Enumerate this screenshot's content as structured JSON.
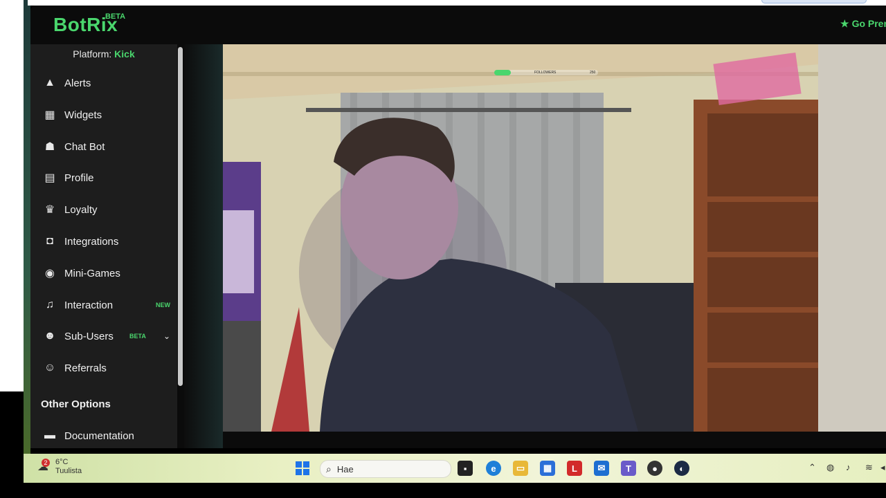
{
  "app": {
    "logo": "BotRix",
    "logo_badge": "BETA",
    "go_premium": "Go Prer"
  },
  "sidebar": {
    "platform_label": "Platform:",
    "platform_value": "Kick",
    "items": [
      {
        "label": "Alerts",
        "icon": "warning-icon"
      },
      {
        "label": "Widgets",
        "icon": "grid-icon"
      },
      {
        "label": "Chat Bot",
        "icon": "robot-icon"
      },
      {
        "label": "Profile",
        "icon": "id-card-icon"
      },
      {
        "label": "Loyalty",
        "icon": "trophy-icon"
      },
      {
        "label": "Integrations",
        "icon": "chat-icon"
      },
      {
        "label": "Mini-Games",
        "icon": "gamepad-icon"
      },
      {
        "label": "Interaction",
        "icon": "music-icon",
        "badge": "NEW"
      },
      {
        "label": "Sub-Users",
        "icon": "users-icon",
        "badge": "BETA"
      },
      {
        "label": "Referrals",
        "icon": "user-friends-icon"
      }
    ],
    "section_title": "Other Options",
    "other_items": [
      {
        "label": "Documentation",
        "icon": "book-icon"
      }
    ]
  },
  "video_overlay": {
    "label": "FOLLOWERS",
    "current": "63",
    "target": "250",
    "progress": 0.16
  },
  "taskbar": {
    "weather_badge": "2",
    "weather_temp": "6°C",
    "weather_desc": "Tuulista",
    "search_placeholder": "Hae",
    "apps": [
      "task-view-icon",
      "edge-icon",
      "file-explorer-icon",
      "store-icon",
      "l-app-icon",
      "outlook-icon",
      "teams-icon",
      "obs-icon",
      "steam-icon"
    ]
  },
  "colors": {
    "accent": "#4ad66d",
    "sidebar_bg": "#1d1d1d",
    "app_bg": "#0b0b0b"
  }
}
